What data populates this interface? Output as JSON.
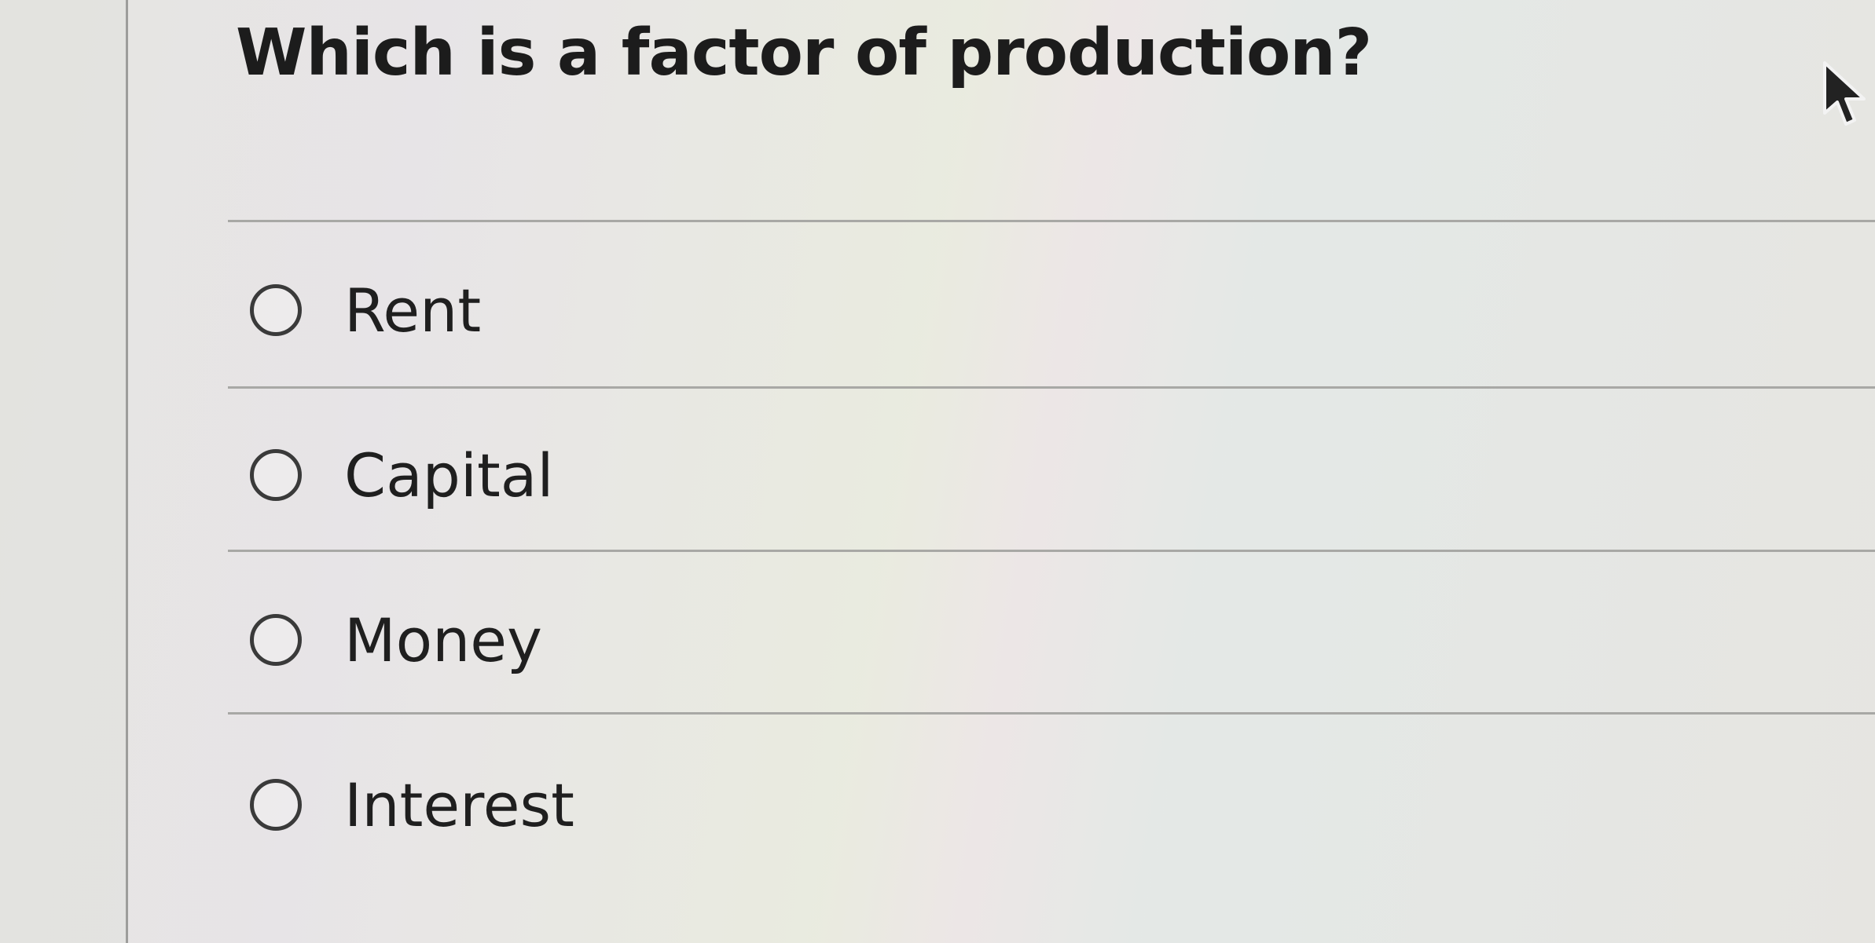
{
  "question": {
    "text": "Which is a factor of production?"
  },
  "options": [
    {
      "label": "Rent",
      "selected": false
    },
    {
      "label": "Capital",
      "selected": false
    },
    {
      "label": "Money",
      "selected": false
    },
    {
      "label": "Interest",
      "selected": false
    }
  ],
  "icons": {
    "cursor": "mouse-pointer-icon",
    "radio": "radio-unchecked-icon"
  },
  "colors": {
    "background": "#e6e5e1",
    "text": "#1f1f1f",
    "divider": "#a8a8a5",
    "radio_border": "#3a3a3a"
  }
}
